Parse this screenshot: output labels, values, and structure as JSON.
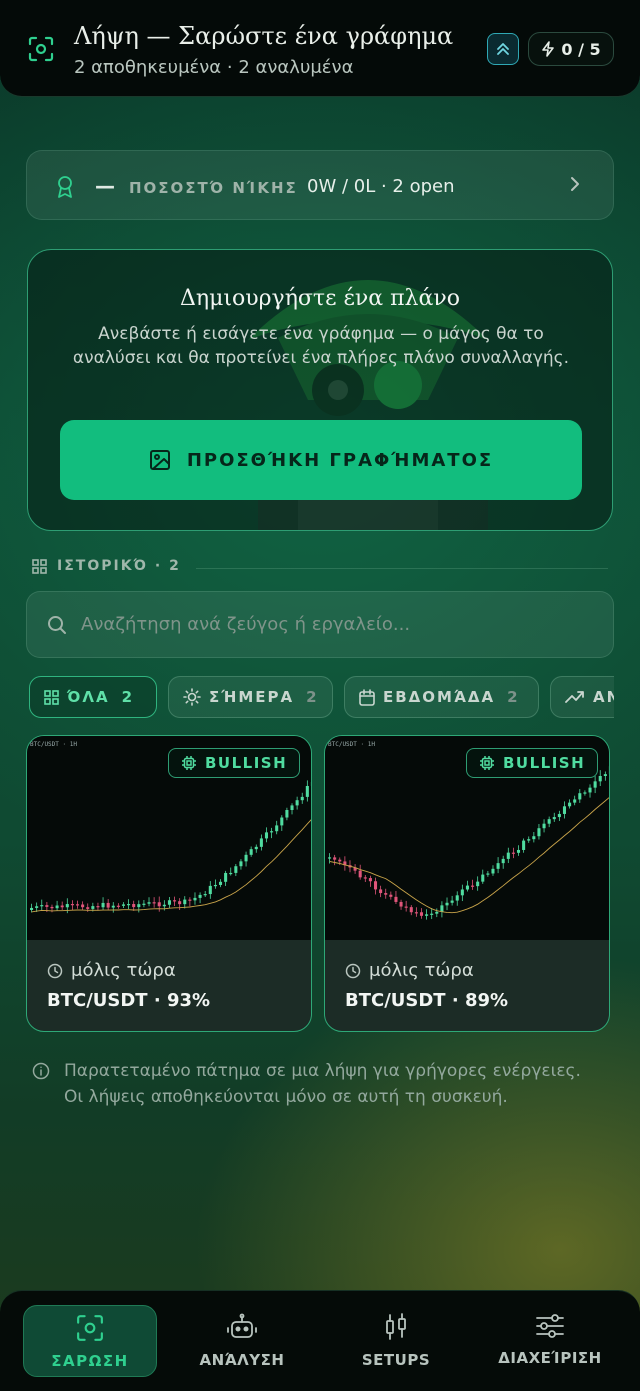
{
  "header": {
    "title": "Λήψη — Σαρώστε ένα γράφημα",
    "subtitle": "2 αποθηκευμένα · 2 αναλυμένα",
    "credits": "0 / 5",
    "scan_icon": "scan-frame-icon",
    "rank_icon": "chevrons-up-icon",
    "credits_icon": "lightning-icon"
  },
  "win_rate": {
    "dash": "—",
    "label": "ΠΟΣΟΣΤΌ ΝΊΚΗΣ",
    "value": "0W / 0L · 2 open"
  },
  "create": {
    "title": "Δημιουργήστε ένα πλάνο",
    "description": "Ανεβάστε ή εισάγετε ένα γράφημα — ο μάγος θα το αναλύσει και θα προτείνει ένα πλήρες πλάνο συναλλαγής.",
    "button_label": "ΠΡΟΣΘΉΚΗ ΓΡΑΦΉΜΑΤΟΣ"
  },
  "history": {
    "label": "ΙΣΤΟΡΙΚΌ · 2"
  },
  "search": {
    "placeholder": "Αναζήτηση ανά ζεύγος ή εργαλείο..."
  },
  "filters": [
    {
      "label": "ΌΛΑ",
      "count": "2",
      "icon": "grid-icon",
      "active": true
    },
    {
      "label": "ΣΉΜΕΡΑ",
      "count": "2",
      "icon": "sun-icon",
      "active": false
    },
    {
      "label": "ΕΒΔΟΜΆΔΑ",
      "count": "2",
      "icon": "calendar-icon",
      "active": false
    },
    {
      "label": "ΑΝ",
      "count": "",
      "icon": "trending-up-icon",
      "active": false
    }
  ],
  "scans": [
    {
      "badge": "BULLISH",
      "time": "μόλις τώρα",
      "pair": "BTC/USDT · 93%",
      "chart_tag": "BTC/USDT · 1H"
    },
    {
      "badge": "BULLISH",
      "time": "μόλις τώρα",
      "pair": "BTC/USDT · 89%",
      "chart_tag": "BTC/USDT · 1H"
    }
  ],
  "hint": "Παρατεταμένο πάτημα σε μια λήψη για γρήγορες ενέργειες. Οι λήψεις αποθηκεύονται μόνο σε αυτή τη συσκευή.",
  "nav": [
    {
      "label": "ΣΑΡΩΣΗ",
      "icon": "scan-frame-icon",
      "active": true
    },
    {
      "label": "ΑΝΆΛΥΣΗ",
      "icon": "robot-icon",
      "active": false
    },
    {
      "label": "SETUPS",
      "icon": "candlestick-icon",
      "active": false
    },
    {
      "label": "ΔΙΑΧΕΊΡΙΣΗ",
      "icon": "sliders-icon",
      "active": false
    }
  ],
  "colors": {
    "accent": "#12bd7e",
    "accent_text": "#2fd08f",
    "bullish": "#50dca0",
    "bearish": "#e0557a",
    "header_bg": "#040a08"
  }
}
